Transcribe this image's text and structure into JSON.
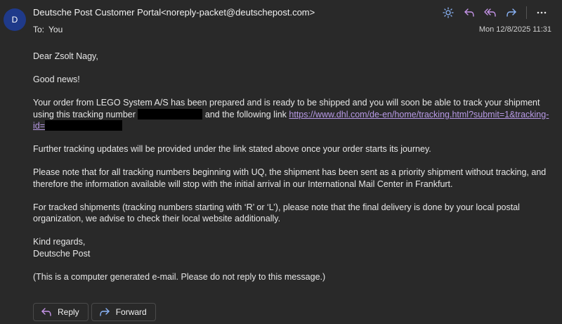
{
  "email": {
    "avatar_initial": "D",
    "sender": "Deutsche Post Customer Portal<noreply-packet@deutschepost.com>",
    "to_label": "To:",
    "to_value": "You",
    "date": "Mon 12/8/2025 11:31",
    "greeting": "Dear Zsolt Nagy,",
    "para1": "Good news!",
    "para2_part1": "Your order from LEGO System A/S has been prepared and is ready to be shipped and you will soon be able to track your shipment using this tracking number",
    "para2_part2": "and the following link",
    "link_text": "https://www.dhl.com/de-en/home/tracking.html?submit=1&tracking-id=",
    "para3": "Further tracking updates will be provided under the link stated above once your order starts its journey.",
    "para4": "Please note that for all tracking numbers beginning with UQ, the shipment has been sent as a priority shipment without tracking, and therefore the information available will stop with the initial arrival in our International Mail Center in Frankfurt.",
    "para5": "For tracked shipments (tracking numbers starting with ‘R’ or ‘L’), please note that the final delivery is done by your local postal organization, we advise to check their local website additionally.",
    "closing": "Kind regards,",
    "signature": "Deutsche Post",
    "disclaimer": "(This is a computer generated e-mail. Please do not reply to this message.)"
  },
  "footer": {
    "reply_label": "Reply",
    "forward_label": "Forward"
  },
  "toolbar": {
    "icons": [
      "sun-icon",
      "reply-icon",
      "reply-all-icon",
      "forward-icon",
      "more-icon"
    ]
  },
  "colors": {
    "background": "#292929",
    "accent": "#8ab4f8",
    "link": "#b89ae6",
    "reply_icon": "#c594e8"
  }
}
